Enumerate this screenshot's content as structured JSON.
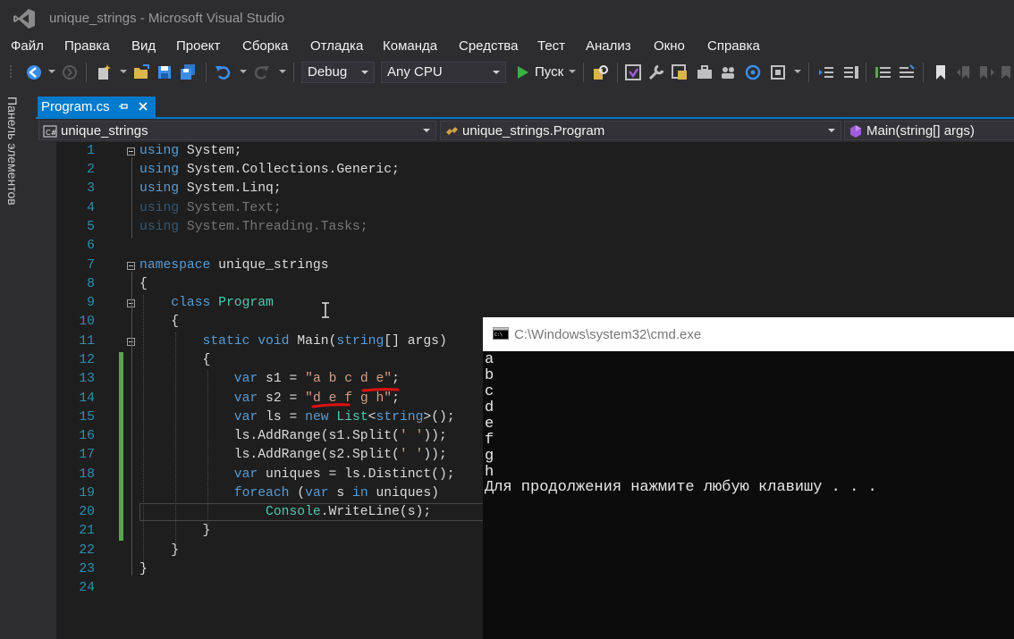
{
  "window": {
    "title": "unique_strings - Microsoft Visual Studio"
  },
  "menu": [
    "Файл",
    "Правка",
    "Вид",
    "Проект",
    "Сборка",
    "Отладка",
    "Команда",
    "Средства",
    "Тест",
    "Анализ",
    "Окно",
    "Справка"
  ],
  "toolbar": {
    "configuration": "Debug",
    "platform": "Any CPU",
    "run_label": "Пуск",
    "accent_color": "#007acc",
    "run_color": "#3cb043"
  },
  "side_panel": {
    "toolbox_label": "Панель элементов"
  },
  "document_tab": {
    "label": "Program.cs"
  },
  "navigation": {
    "project": "unique_strings",
    "class": "unique_strings.Program",
    "member": "Main(string[] args)"
  },
  "editor": {
    "line_numbers": [
      "1",
      "2",
      "3",
      "4",
      "5",
      "6",
      "7",
      "8",
      "9",
      "10",
      "11",
      "12",
      "13",
      "14",
      "15",
      "16",
      "17",
      "18",
      "19",
      "20",
      "21",
      "22",
      "23",
      "24"
    ],
    "lines": [
      "using System;",
      "using System.Collections.Generic;",
      "using System.Linq;",
      "using System.Text;",
      "using System.Threading.Tasks;",
      "",
      "namespace unique_strings",
      "{",
      "    class Program",
      "    {",
      "        static void Main(string[] args)",
      "        {",
      "            var s1 = \"a b c d e\";",
      "            var s2 = \"d e f g h\";",
      "            var ls = new List<string>();",
      "            ls.AddRange(s1.Split(' '));",
      "            ls.AddRange(s2.Split(' '));",
      "            var uniques = ls.Distinct();",
      "            foreach (var s in uniques)",
      "                Console.WriteLine(s);",
      "        }",
      "    }",
      "}",
      ""
    ],
    "annotation_color": "#e01010"
  },
  "console": {
    "title": "C:\\Windows\\system32\\cmd.exe",
    "output": [
      "a",
      "b",
      "c",
      "d",
      "e",
      "f",
      "g",
      "h"
    ],
    "prompt": "Для продолжения нажмите любую клавишу . . ."
  }
}
